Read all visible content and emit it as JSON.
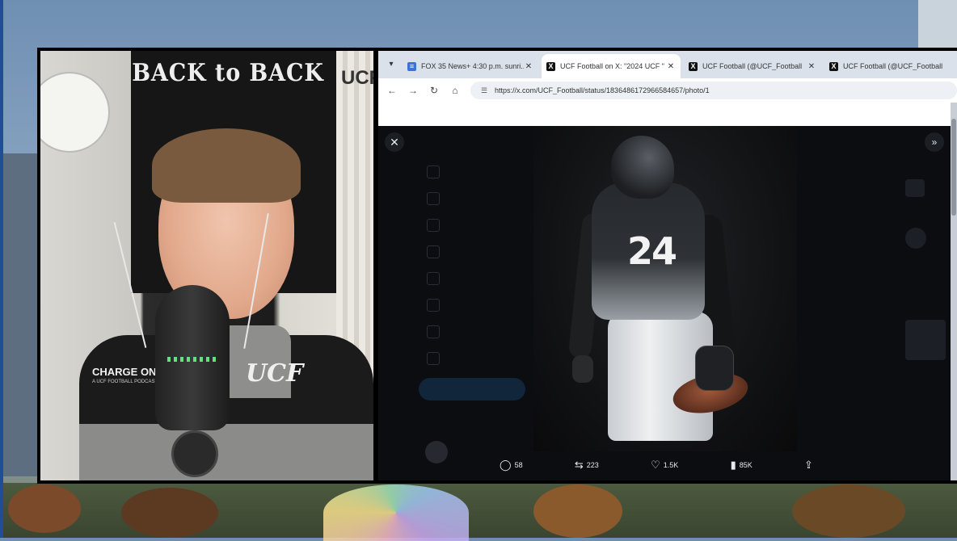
{
  "webcam": {
    "poster_text": "BACK to BACK",
    "wall_logo": "UCF",
    "shirt_text": "CHARGE ON",
    "shirt_subtext": "A UCF FOOTBALL PODCAST",
    "shirt_logo": "UCF"
  },
  "browser": {
    "tabs": [
      {
        "label": "FOX 35 News+ 4:30 p.m. sunri...",
        "favicon": "doc",
        "active": false
      },
      {
        "label": "UCF Football on X: \"2024 UCF \"",
        "favicon": "x",
        "active": true
      },
      {
        "label": "UCF Football (@UCF_Football",
        "favicon": "x",
        "active": false
      },
      {
        "label": "UCF Football (@UCF_Football",
        "favicon": "x",
        "active": false
      }
    ],
    "url": "https://x.com/UCF_Football/status/1836486172966584657/photo/1",
    "icons": {
      "tab_menu": "chevron-down-icon",
      "back": "arrow-left-icon",
      "forward": "arrow-right-icon",
      "reload": "reload-icon",
      "home": "home-icon",
      "site_info": "tune-icon"
    }
  },
  "viewer": {
    "jersey_number": "24",
    "actions": {
      "replies": "58",
      "reposts": "223",
      "likes": "1.5K",
      "views": "85K"
    }
  },
  "colors": {
    "brand_blue": "#214d97",
    "x_dark": "#0b0d10"
  }
}
